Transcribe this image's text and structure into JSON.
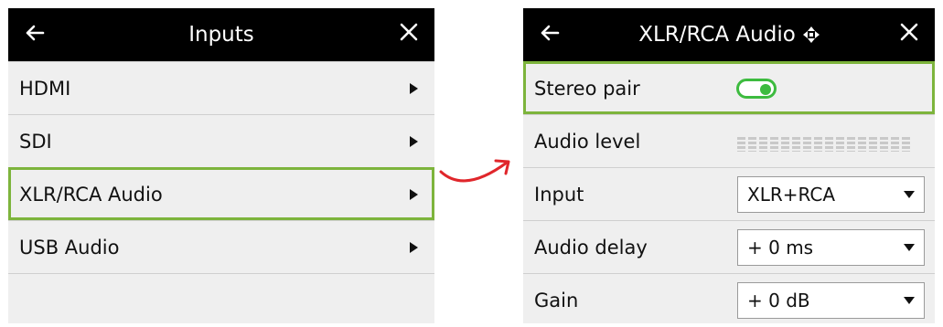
{
  "left_panel": {
    "title": "Inputs",
    "items": [
      {
        "label": "HDMI",
        "selected": false
      },
      {
        "label": "SDI",
        "selected": false
      },
      {
        "label": "XLR/RCA Audio",
        "selected": true
      },
      {
        "label": "USB Audio",
        "selected": false
      }
    ]
  },
  "right_panel": {
    "title": "XLR/RCA Audio",
    "rows": {
      "stereo_pair": {
        "label": "Stereo pair",
        "toggle_on": true
      },
      "audio_level": {
        "label": "Audio level"
      },
      "input": {
        "label": "Input",
        "value": "XLR+RCA"
      },
      "audio_delay": {
        "label": "Audio delay",
        "value": "+ 0 ms"
      },
      "gain": {
        "label": "Gain",
        "value": "+ 0 dB"
      }
    }
  },
  "icons": {
    "back": "arrow-left-icon",
    "close": "close-icon",
    "title_move": "move-arrows-icon",
    "item_arrow": "chevron-right-icon",
    "connector": "curved-arrow-icon"
  },
  "colors": {
    "header_bg": "#000000",
    "panel_bg": "#efefef",
    "highlight": "#7db43c",
    "toggle_on": "#3dbb3f",
    "connector": "#e0262b"
  }
}
